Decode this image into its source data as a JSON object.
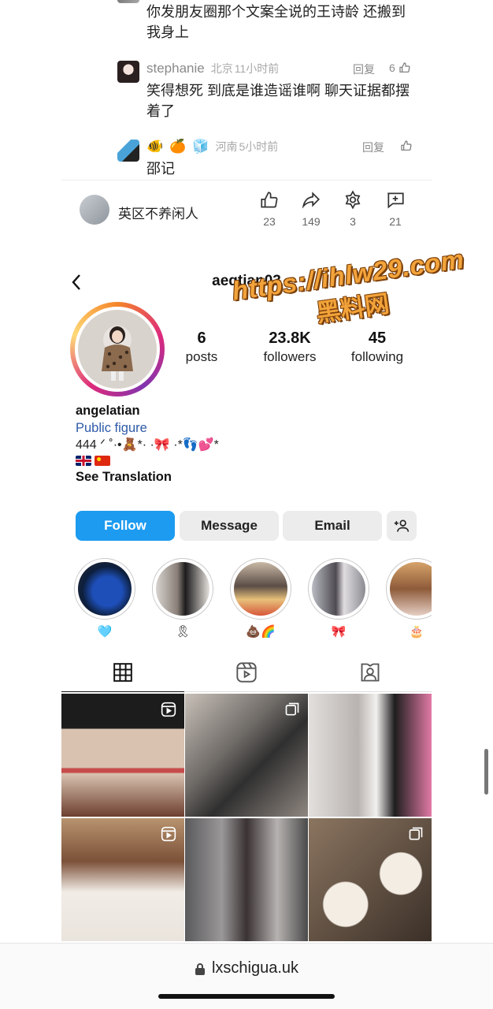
{
  "comments": [
    {
      "name": "",
      "location": "",
      "time": "",
      "reply_label": "",
      "likes": "",
      "text_lines": [
        "你发朋友圈那个文案全说的王诗龄 还搬到",
        "我身上"
      ]
    },
    {
      "name": "stephanie",
      "location": "北京",
      "time": "11小时前",
      "reply_label": "回复",
      "likes": "6",
      "text_lines": [
        "笑得想死 到底是谁造谣谁啊 聊天证据都摆",
        "着了"
      ]
    },
    {
      "name": "",
      "location": "河南",
      "time": "5小时前",
      "reply_label": "回复",
      "likes": "",
      "text_lines": [
        "邵记"
      ]
    }
  ],
  "post_bar": {
    "author": "英区不养闲人",
    "likes": "23",
    "shares": "149",
    "gifts": "3",
    "comments": "21"
  },
  "instagram": {
    "username": "aeqtian03",
    "stats": [
      {
        "value": "6",
        "label": "posts"
      },
      {
        "value": "23.8K",
        "label": "followers"
      },
      {
        "value": "45",
        "label": "following"
      }
    ],
    "full_name": "angelatian",
    "category": "Public figure",
    "bio": "444 ᐟ ˚·•🧸*· ·🎀 ·*👣💕*",
    "see_translation": "See Translation",
    "buttons": {
      "follow": "Follow",
      "message": "Message",
      "email": "Email"
    },
    "highlights": [
      "🩵",
      "🎗",
      "💩🌈",
      "🎀",
      "🎂"
    ]
  },
  "watermark": {
    "url": "https://ihlw29.com",
    "cn": "黑料网"
  },
  "browser": {
    "url": "lxschigua.uk"
  },
  "colors": {
    "follow_blue": "#1d9bf0",
    "category_blue": "#2f5aa8",
    "watermark_orange": "#f2a33a"
  }
}
